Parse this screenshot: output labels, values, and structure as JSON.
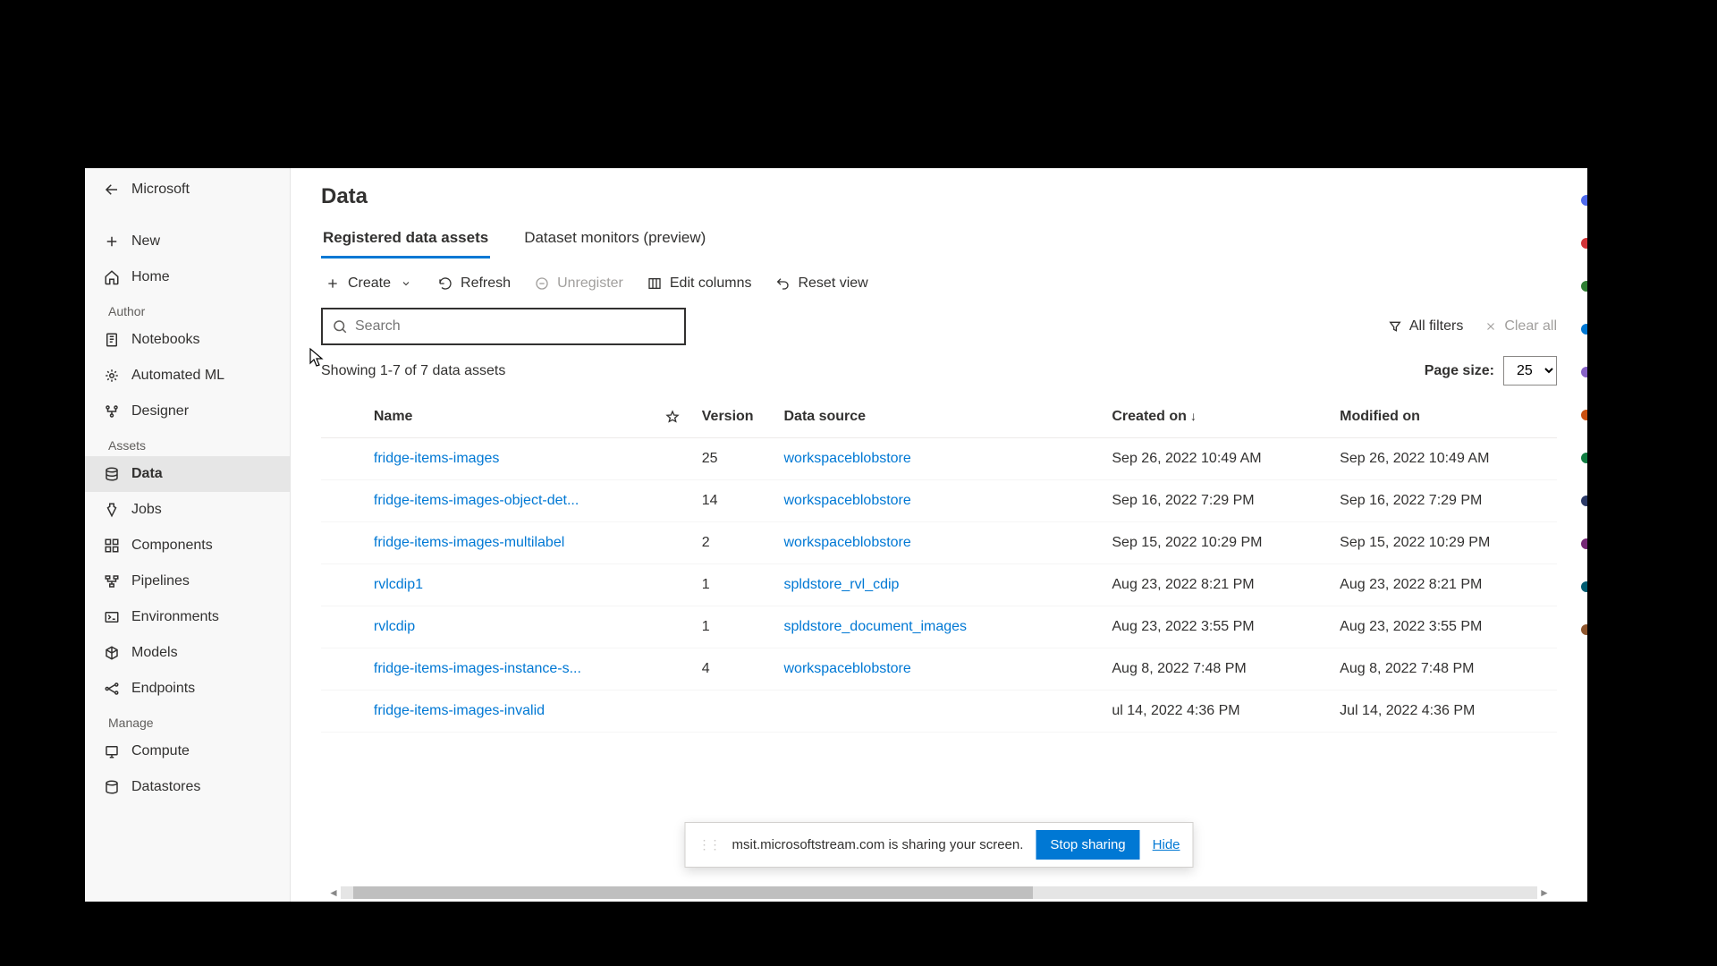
{
  "sidebar": {
    "back_label": "Microsoft",
    "new_label": "New",
    "home_label": "Home",
    "sections": {
      "author": "Author",
      "assets": "Assets",
      "manage": "Manage"
    },
    "author_items": {
      "notebooks": "Notebooks",
      "automl": "Automated ML",
      "designer": "Designer"
    },
    "asset_items": {
      "data": "Data",
      "jobs": "Jobs",
      "components": "Components",
      "pipelines": "Pipelines",
      "environments": "Environments",
      "models": "Models",
      "endpoints": "Endpoints"
    },
    "manage_items": {
      "compute": "Compute",
      "datastores": "Datastores"
    }
  },
  "page": {
    "title": "Data",
    "tabs": {
      "registered": "Registered data assets",
      "monitors": "Dataset monitors (preview)"
    }
  },
  "toolbar": {
    "create": "Create",
    "refresh": "Refresh",
    "unregister": "Unregister",
    "edit_columns": "Edit columns",
    "reset_view": "Reset view"
  },
  "search": {
    "placeholder": "Search"
  },
  "filters": {
    "all_filters": "All filters",
    "clear_all": "Clear all"
  },
  "count_text": "Showing 1-7 of 7 data assets",
  "page_size_label": "Page size:",
  "page_size_value": "25",
  "columns": {
    "name": "Name",
    "version": "Version",
    "data_source": "Data source",
    "created_on": "Created on",
    "modified_on": "Modified on"
  },
  "rows": [
    {
      "name": "fridge-items-images",
      "version": "25",
      "source": "workspaceblobstore",
      "created": "Sep 26, 2022 10:49 AM",
      "modified": "Sep 26, 2022 10:49 AM"
    },
    {
      "name": "fridge-items-images-object-det...",
      "version": "14",
      "source": "workspaceblobstore",
      "created": "Sep 16, 2022 7:29 PM",
      "modified": "Sep 16, 2022 7:29 PM"
    },
    {
      "name": "fridge-items-images-multilabel",
      "version": "2",
      "source": "workspaceblobstore",
      "created": "Sep 15, 2022 10:29 PM",
      "modified": "Sep 15, 2022 10:29 PM"
    },
    {
      "name": "rvlcdip1",
      "version": "1",
      "source": "spldstore_rvl_cdip",
      "created": "Aug 23, 2022 8:21 PM",
      "modified": "Aug 23, 2022 8:21 PM"
    },
    {
      "name": "rvlcdip",
      "version": "1",
      "source": "spldstore_document_images",
      "created": "Aug 23, 2022 3:55 PM",
      "modified": "Aug 23, 2022 3:55 PM"
    },
    {
      "name": "fridge-items-images-instance-s...",
      "version": "4",
      "source": "workspaceblobstore",
      "created": "Aug 8, 2022 7:48 PM",
      "modified": "Aug 8, 2022 7:48 PM"
    },
    {
      "name": "fridge-items-images-invalid",
      "version": "",
      "source": "",
      "created": "ul 14, 2022 4:36 PM",
      "modified": "Jul 14, 2022 4:36 PM"
    }
  ],
  "share_bar": {
    "message": "msit.microsoftstream.com is sharing your screen.",
    "stop": "Stop sharing",
    "hide": "Hide"
  }
}
